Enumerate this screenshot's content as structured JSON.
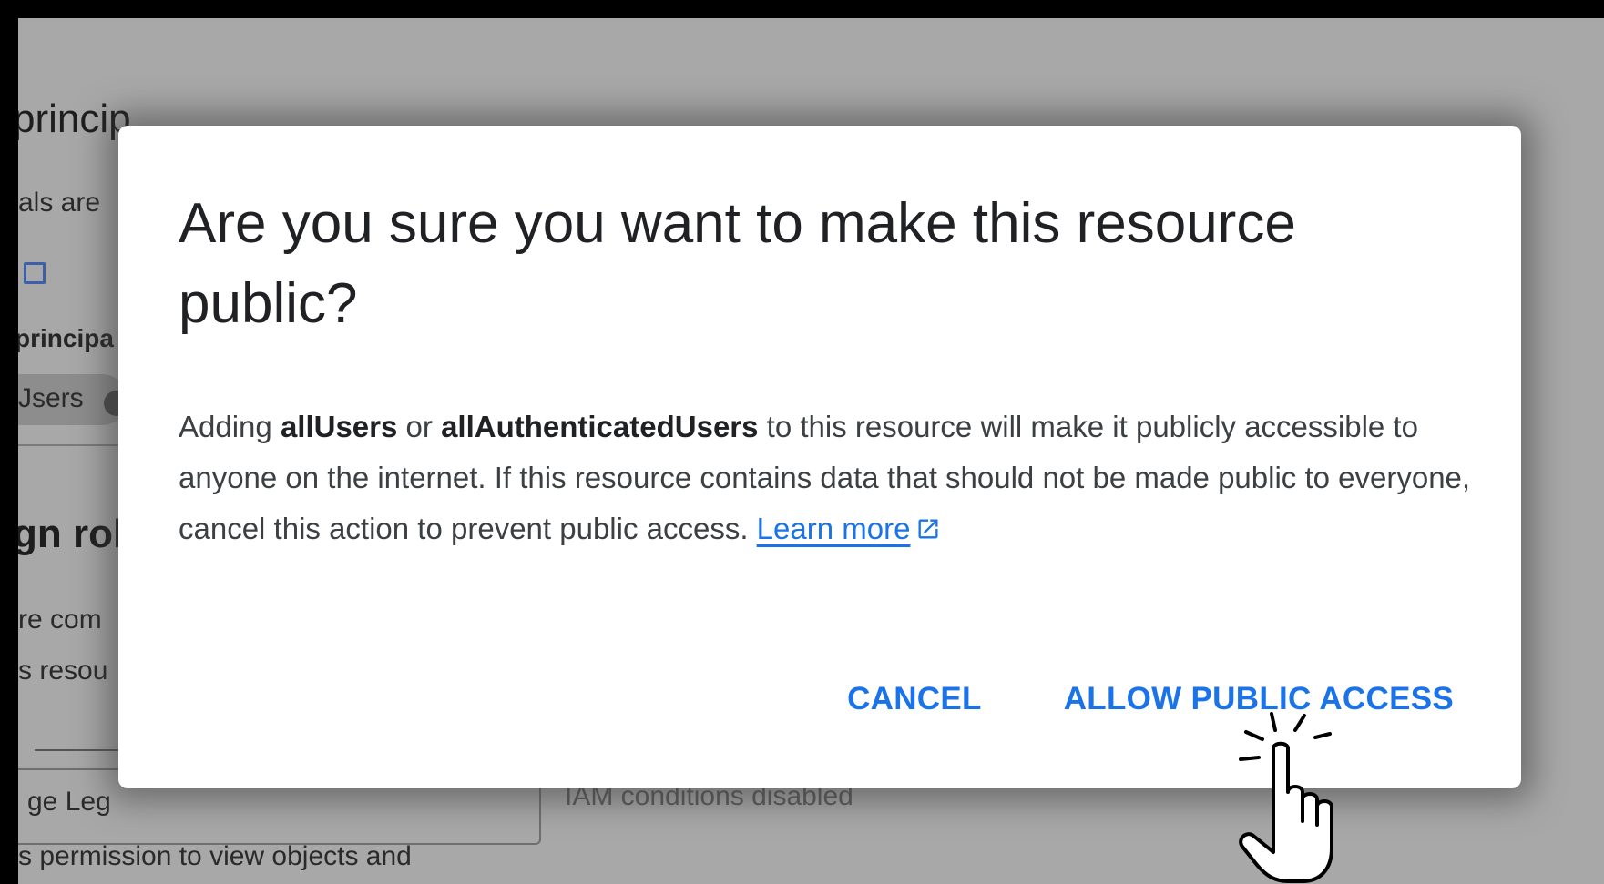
{
  "background_page": {
    "heading_principals": "princip",
    "principals_desc": "als are",
    "principal_label": "principa",
    "chip_text": "Jsers",
    "heading_roles": "gn rol",
    "roles_desc_1": "re com",
    "roles_desc_2": "s resou",
    "role_field_text": "ge Leg",
    "role_desc": "s permission to view objects and",
    "iam_conditions": "IAM conditions disabled"
  },
  "dialog": {
    "title": "Are you sure you want to make this resource public?",
    "body": {
      "part1": "Adding ",
      "bold1": "allUsers",
      "part2": " or ",
      "bold2": "allAuthenticatedUsers",
      "part3": " to this resource will make it publicly accessible to anyone on the internet. If this resource contains data that should not be made public to everyone, cancel this action to prevent public access. ",
      "link": "Learn more"
    },
    "actions": {
      "cancel": "CANCEL",
      "allow": "ALLOW PUBLIC ACCESS"
    }
  },
  "colors": {
    "accent": "#1a73e8",
    "scrim": "#a8a8a8",
    "title_text": "#202124",
    "body_text": "#3c4043"
  },
  "icons": {
    "external_link": "open-in-new-icon",
    "cursor": "hand-pointer-icon"
  }
}
